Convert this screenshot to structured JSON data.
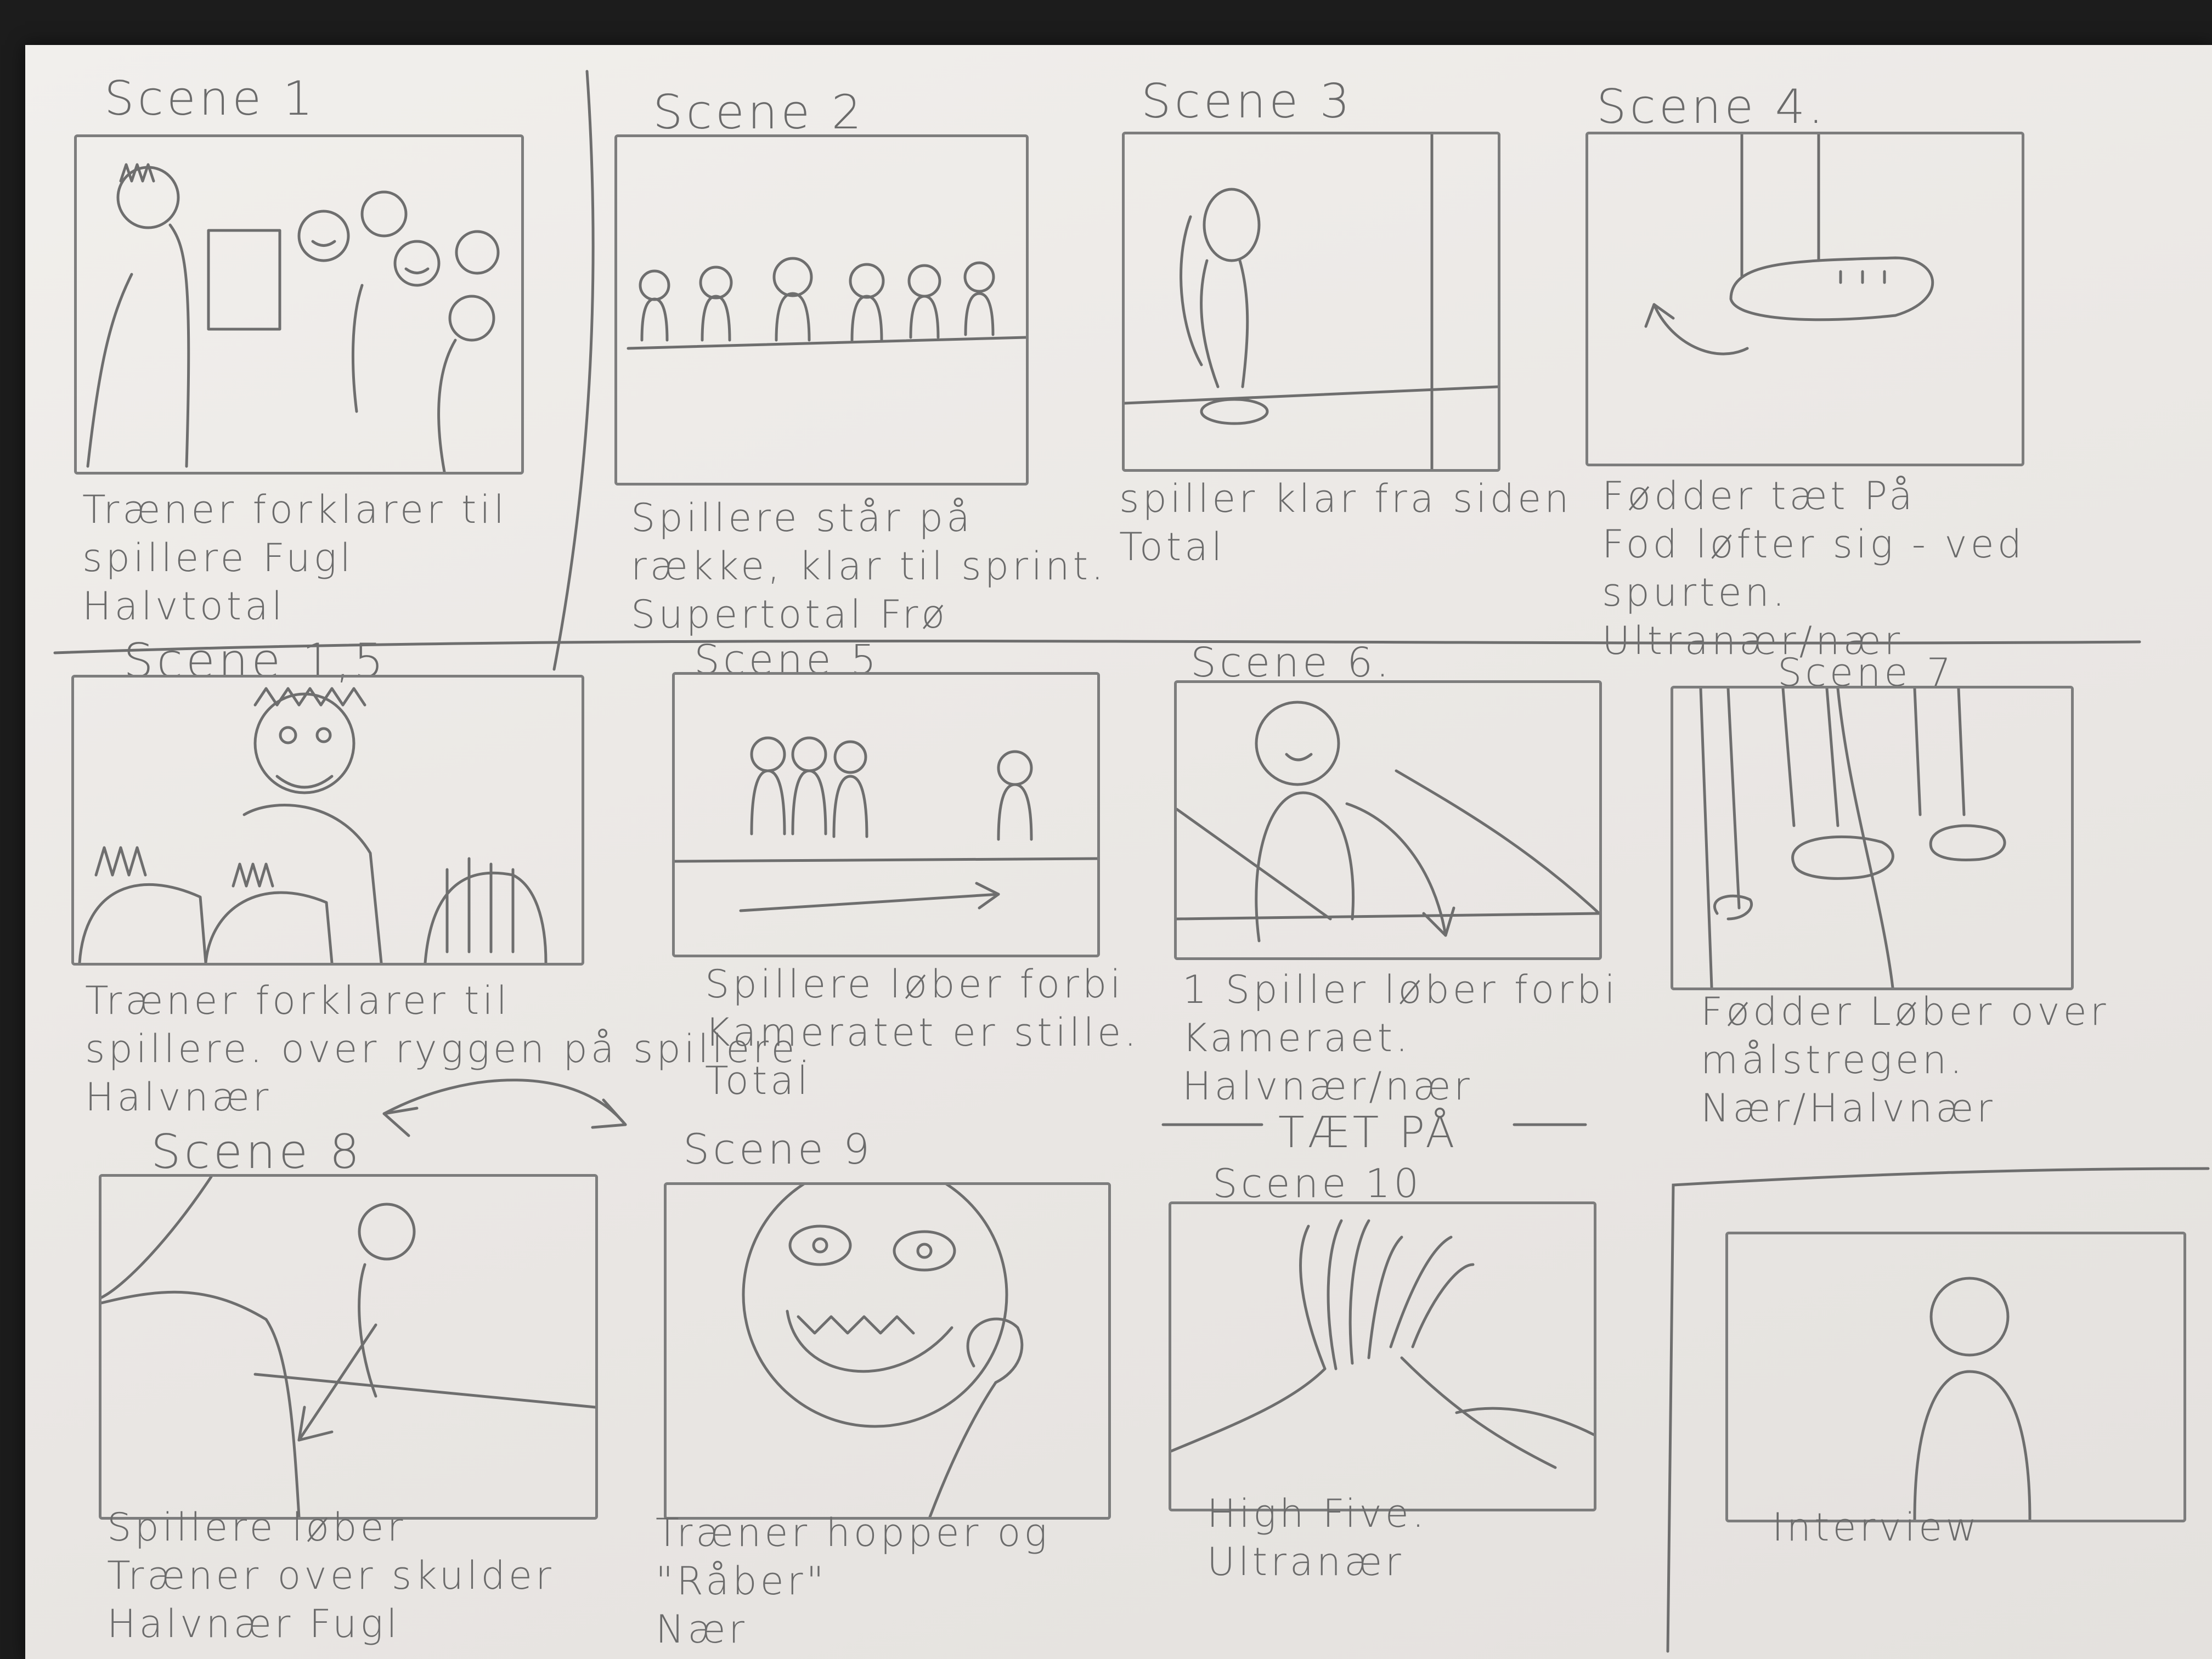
{
  "scenes": [
    {
      "title": "Scene 1",
      "caption": "Træner forklarer til\nspillere      Fugl\nHalvtotal"
    },
    {
      "title": "Scene 2",
      "caption": "Spillere står på\nrække, klar til sprint.\nSupertotal Frø"
    },
    {
      "title": "Scene 3",
      "caption": "spiller klar fra siden\nTotal"
    },
    {
      "title": "Scene 4.",
      "caption": "Fødder tæt På\nFod løfter sig - ved\nspurten.\nUltranær/nær"
    },
    {
      "title": "Scene 1,5",
      "caption": "Træner forklarer til\nspillere. over ryggen på spillere.\nHalvnær"
    },
    {
      "title": "Scene 5",
      "caption": "Spillere løber forbi\nKameratet er stille.\nTotal"
    },
    {
      "title": "Scene 6.",
      "caption": "1 Spiller løber forbi\nKameraet.\nHalvnær/nær"
    },
    {
      "title": "Scene 7",
      "caption": "Fødder Løber over\nmålstregen.\nNær/Halvnær"
    },
    {
      "title": "Scene 8",
      "caption": "Spillere løber\nTræner over skulder\nHalvnær          Fugl"
    },
    {
      "title": "Scene 9",
      "caption": "Træner hopper og\n\"Råber\"\nNær"
    },
    {
      "title": "Scene 10",
      "caption": "High Five.\nUltranær"
    },
    {
      "title": "",
      "caption": "Interview"
    }
  ],
  "notes": {
    "tat_pa": "TÆT PÅ"
  },
  "colors": {
    "paper": "#ebe8e5",
    "pencil": "#6e6e6e",
    "background": "#1c1c1c"
  }
}
